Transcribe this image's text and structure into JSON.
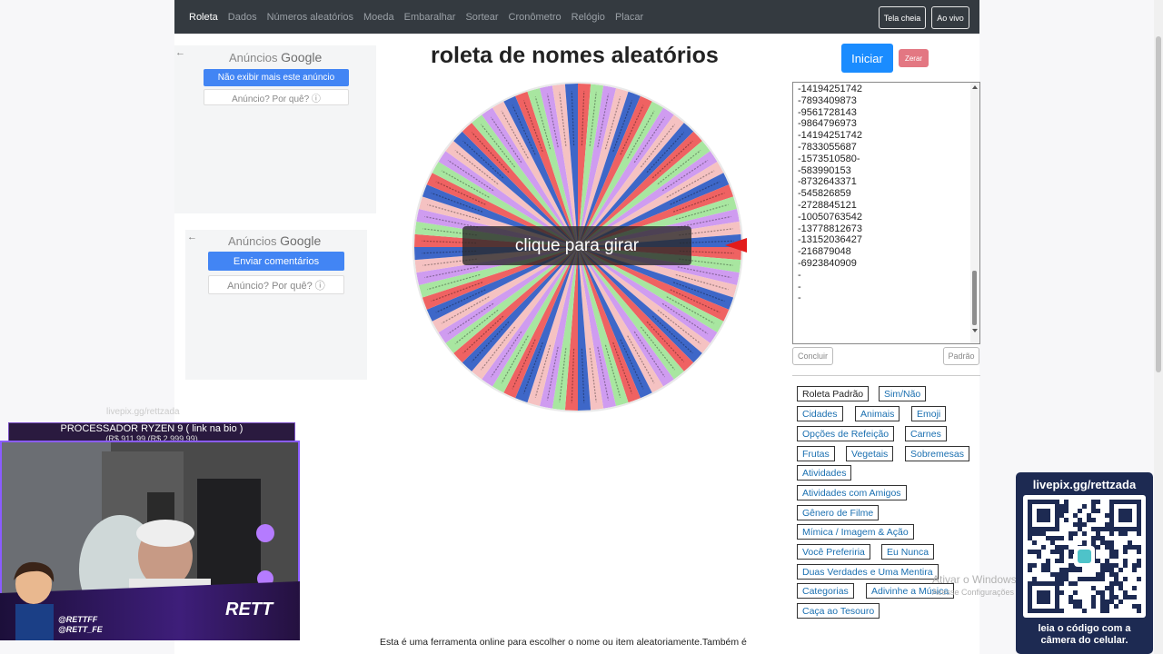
{
  "navbar": {
    "items": [
      "Roleta",
      "Dados",
      "Números aleatórios",
      "Moeda",
      "Embaralhar",
      "Sortear",
      "Cronômetro",
      "Relógio",
      "Placar"
    ],
    "active_index": 0,
    "fullscreen_label": "Tela cheia",
    "live_label": "Ao vivo"
  },
  "ads": {
    "ad1": {
      "brand_prefix": "Anúncios",
      "brand": "Google",
      "primary": "Não exibir mais este anúncio",
      "secondary": "Anúncio? Por quê? ⓘ"
    },
    "ad2": {
      "brand_prefix": "Anúncios",
      "brand": "Google",
      "primary": "Enviar comentários",
      "secondary": "Anúncio? Por quê? ⓘ"
    }
  },
  "page": {
    "title": "roleta de nomes aleatórios",
    "spin_label": "clique para girar"
  },
  "controls": {
    "start_label": "Iniciar",
    "reset_label": "Zerar",
    "conclude_label": "Concluir",
    "default_label": "Padrão"
  },
  "names": [
    "-14194251742",
    "-7893409873",
    "-9561728143",
    "-9864796973",
    "-14194251742",
    "-7833055687",
    "-1573510580-",
    "-583990153",
    "-8732643371",
    "-545826859",
    "-2728845121",
    "-10050763542",
    "-13778812673",
    "-13152036427",
    "-216879048",
    "-6923840909",
    "-",
    "-",
    "-"
  ],
  "presets": [
    "Roleta Padrão",
    "Sim/Não",
    "Cidades",
    "Animais",
    "Emoji",
    "Opções de Refeição",
    "Carnes",
    "Frutas",
    "Vegetais",
    "Sobremesas",
    "Atividades",
    "Atividades com Amigos",
    "Gênero de Filme",
    "Mímica / Imagem & Ação",
    "Você Preferiria",
    "Eu Nunca",
    "Duas Verdades e Uma Mentira",
    "Categorias",
    "Adivinhe a Música",
    "Caça ao Tesouro"
  ],
  "description": "Esta é uma ferramenta online para escolher o nome ou item aleatoriamente.Também é",
  "watermark": {
    "line1": "Ativar o Windows",
    "line2": "Acesse Configurações"
  },
  "livepix": {
    "title": "livepix.gg/rettzada",
    "footer_line1": "leia o código com a",
    "footer_line2": "câmera do celular."
  },
  "stream": {
    "top_text": "livepix.gg/rettzada",
    "banner": "PROCESSADOR RYZEN 9 ( link na bio )",
    "banner_sub": "(R$ 911,99 (R$ 2.999,99)",
    "handle1": "@RETTFF",
    "handle2": "@RETT_FE",
    "logo": "RETT"
  },
  "colors": {
    "wheel": [
      "#ef6262",
      "#a8e6a0",
      "#cf9cf0",
      "#f5c2c2",
      "#3e67c8"
    ],
    "navbar": "#343a40",
    "start": "#1a8cff",
    "reset": "#e37782",
    "pointer": "#e21b1b"
  }
}
